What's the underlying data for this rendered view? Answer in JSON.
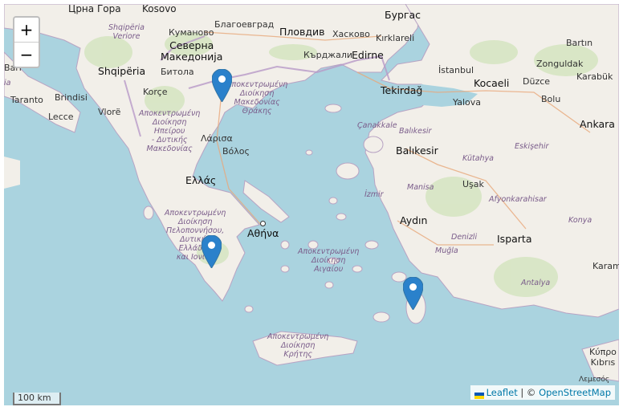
{
  "zoom": {
    "in_label": "+",
    "out_label": "−"
  },
  "scale_label": "100 km",
  "attribution": {
    "leaflet": "Leaflet",
    "separator": "|",
    "copyright": "©",
    "osm": "OpenStreetMap"
  },
  "colors": {
    "sea": "#aad3df",
    "land": "#f2efe9",
    "marker": "#2a81cb",
    "region_label": "#7a5c8a"
  },
  "labels": {
    "crna_gora": "Црна Гора",
    "kosovo": "Kosovo",
    "skopje_area": "Kumanovo",
    "kumanovo": "Куманово",
    "blagoevgrad": "Благоевград",
    "plovdiv": "Пловдив",
    "haskovo": "Хасково",
    "burgas": "Бургас",
    "kirklareli": "Kırklareli",
    "shqiperia_verior": "Shqipëria\nVeriore",
    "severna": "Северна\nМакедонија",
    "kardzhali": "Кърджали",
    "edirne": "Edirne",
    "istanbul": "İstanbul",
    "bartin": "Bartın",
    "zonguldak": "Zonguldak",
    "karabuk": "Karabük",
    "shqiperia": "Shqipëria",
    "bitola": "Битола",
    "bari": "Bari",
    "taranto": "Taranto",
    "brindisi": "Brindisi",
    "lecce": "Lecce",
    "korce": "Korçe",
    "vlore": "Vlorë",
    "thrace": "Αποκεντρωμένη\nΔιοίκηση\nΜακεδονίας\nΘράκης",
    "tekirdag": "Tekirdağ",
    "kocaeli": "Kocaeli",
    "duzce": "Düzce",
    "bolu": "Bolu",
    "yalova": "Yalova",
    "epirus": "Αποκεντρωμένη\nΔιοίκηση\nΗπείρου\n- Δυτικής\nΜακεδονίας",
    "larisa": "Λάρισα",
    "volos": "Βόλος",
    "canakkale": "Çanakkale",
    "balikesir_r": "Balıkesir",
    "ankara": "Ankara",
    "eskisehir": "Eskişehir",
    "balikesir": "Balıkesir",
    "kutahya": "Kütahya",
    "ellada": "Ελλάς",
    "izmir": "İzmir",
    "manisa": "Manisa",
    "usak": "Uşak",
    "afyon": "Afyonkarahisar",
    "peloponnese": "Αποκεντρωμένη\nΔιοίκηση\nΠελοποννήσου,\nΔυτικής\nΕλλάδας\nκαι Ιονίου",
    "athina": "Αθήνα",
    "aydin": "Aydın",
    "isparta": "Isparta",
    "konya": "Konya",
    "denizli": "Denizli",
    "aegean": "Αποκεντρωμένη\nΔιοίκηση\nΑιγαίου",
    "mugla": "Muğla",
    "antalya": "Antalya",
    "karaman": "Karama",
    "crete": "Αποκεντρωμένη\nΔιοίκηση\nΚρήτης",
    "kypros": "Κύπρο\nKıbrıs",
    "lefkosia": "Λεμεσός",
    "bar_left": "ia"
  },
  "markers": [
    {
      "name": "Thessaloniki"
    },
    {
      "name": "Kalamata"
    },
    {
      "name": "Rhodes"
    }
  ]
}
